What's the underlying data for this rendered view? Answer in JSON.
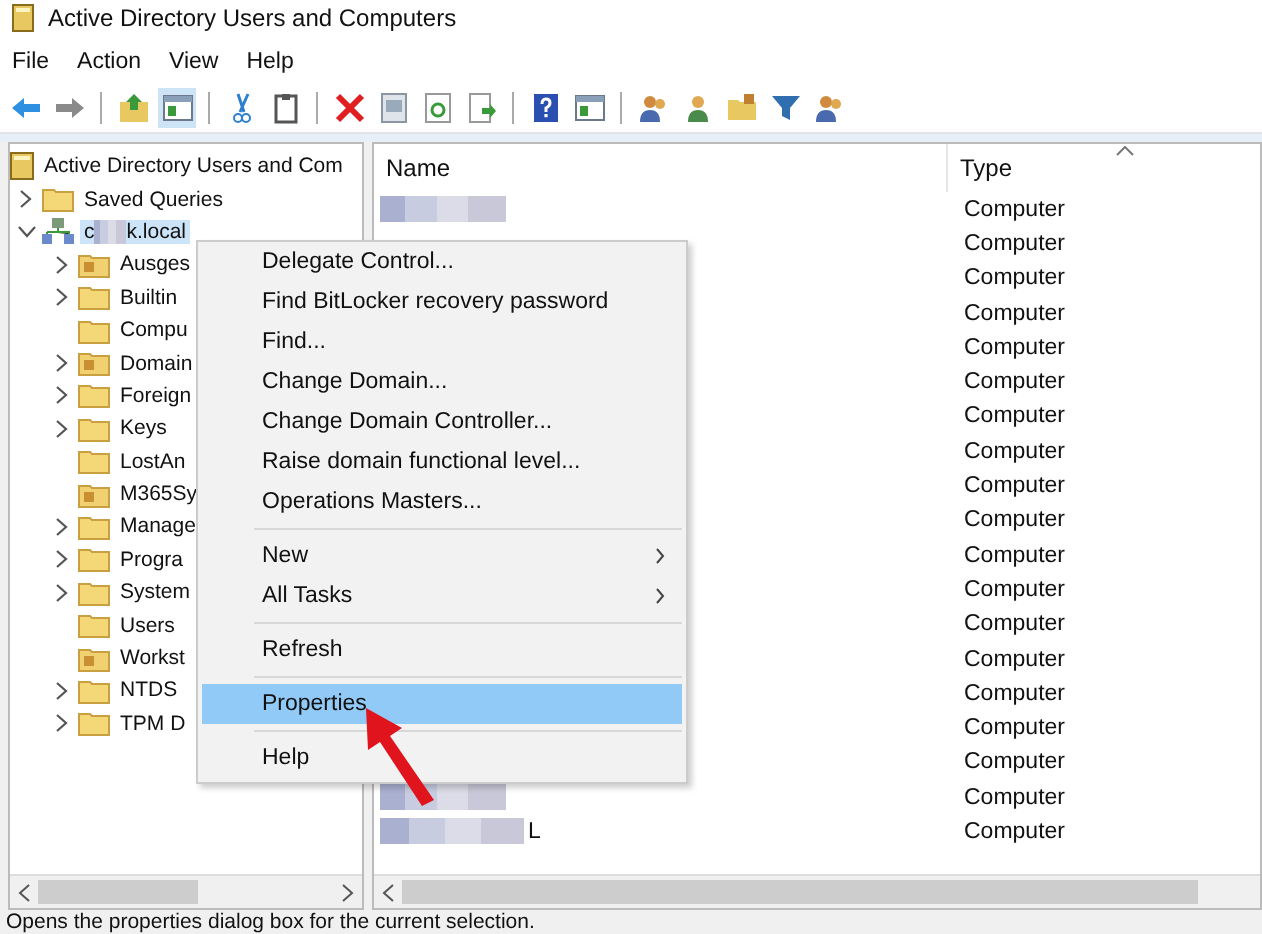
{
  "window": {
    "title": "Active Directory Users and Computers"
  },
  "menu_bar": [
    "File",
    "Action",
    "View",
    "Help"
  ],
  "toolbar": [
    {
      "kind": "back",
      "selected": false
    },
    {
      "kind": "forward",
      "selected": false
    },
    {
      "kind": "separator"
    },
    {
      "kind": "up",
      "selected": false
    },
    {
      "kind": "pane",
      "selected": true
    },
    {
      "kind": "separator"
    },
    {
      "kind": "cut",
      "selected": false
    },
    {
      "kind": "clipboard",
      "selected": false
    },
    {
      "kind": "separator"
    },
    {
      "kind": "delete",
      "selected": false
    },
    {
      "kind": "properties",
      "selected": false
    },
    {
      "kind": "refresh",
      "selected": false
    },
    {
      "kind": "export",
      "selected": false
    },
    {
      "kind": "separator"
    },
    {
      "kind": "help",
      "selected": false
    },
    {
      "kind": "pane",
      "selected": false
    },
    {
      "kind": "separator"
    },
    {
      "kind": "users",
      "selected": false
    },
    {
      "kind": "user",
      "selected": false
    },
    {
      "kind": "folder",
      "selected": false
    },
    {
      "kind": "filter",
      "selected": false
    },
    {
      "kind": "users",
      "selected": false
    }
  ],
  "tree": {
    "label": "Active Directory Users and Com",
    "kind": "root",
    "children": [
      {
        "label": "Saved Queries",
        "kind": "folder",
        "expanded": false,
        "selected": false
      },
      {
        "label": "c",
        "label_after_redaction": "k.local",
        "kind": "domain",
        "expanded": true,
        "selected": true,
        "children": [
          {
            "label": "Ausges",
            "kind": "ou",
            "expanded": false,
            "selected": false
          },
          {
            "label": "Builtin",
            "kind": "folder",
            "expanded": false,
            "selected": false
          },
          {
            "label": "Compu",
            "kind": "folder",
            "selected": false
          },
          {
            "label": "Domain",
            "kind": "ou",
            "expanded": false,
            "selected": false
          },
          {
            "label": "Foreign",
            "kind": "folder",
            "expanded": false,
            "selected": false
          },
          {
            "label": "Keys",
            "kind": "folder",
            "expanded": false,
            "selected": false
          },
          {
            "label": "LostAn",
            "kind": "folder",
            "selected": false
          },
          {
            "label": "M365Sy",
            "kind": "ou",
            "selected": false
          },
          {
            "label": "Manage",
            "kind": "folder",
            "expanded": false,
            "selected": false
          },
          {
            "label": "Progra",
            "kind": "folder",
            "expanded": false,
            "selected": false
          },
          {
            "label": "System",
            "kind": "folder",
            "expanded": false,
            "selected": false
          },
          {
            "label": "Users",
            "kind": "folder",
            "selected": false
          },
          {
            "label": "Workst",
            "kind": "ou",
            "selected": false
          },
          {
            "label": "NTDS",
            "kind": "folder",
            "expanded": false,
            "selected": false
          },
          {
            "label": "TPM D",
            "kind": "folder",
            "expanded": false,
            "selected": false
          }
        ]
      }
    ]
  },
  "table": {
    "columns": [
      {
        "label": "Name",
        "sorted": false
      },
      {
        "label": "Type",
        "sorted": true
      }
    ],
    "rows": [
      {
        "name_redacted": true,
        "type": "Computer"
      },
      {
        "type": "Computer"
      },
      {
        "type": "Computer"
      },
      {
        "type": "Computer"
      },
      {
        "type": "Computer"
      },
      {
        "type": "Computer"
      },
      {
        "type": "Computer"
      },
      {
        "type": "Computer"
      },
      {
        "type": "Computer"
      },
      {
        "type": "Computer"
      },
      {
        "type": "Computer"
      },
      {
        "type": "Computer"
      },
      {
        "type": "Computer"
      },
      {
        "type": "Computer"
      },
      {
        "type": "Computer"
      },
      {
        "type": "Computer"
      },
      {
        "type": "Computer"
      },
      {
        "name_redacted": true,
        "type": "Computer"
      },
      {
        "name_redacted": true,
        "name_after_redaction": "L",
        "type": "Computer"
      }
    ]
  },
  "context_menu": {
    "items": [
      {
        "kind": "item",
        "label": "Delegate Control...",
        "selected": false
      },
      {
        "kind": "item",
        "label": "Find BitLocker recovery password",
        "selected": false
      },
      {
        "kind": "item",
        "label": "Find...",
        "selected": false
      },
      {
        "kind": "item",
        "label": "Change Domain...",
        "selected": false
      },
      {
        "kind": "item",
        "label": "Change Domain Controller...",
        "selected": false
      },
      {
        "kind": "item",
        "label": "Raise domain functional level...",
        "selected": false
      },
      {
        "kind": "item",
        "label": "Operations Masters...",
        "selected": false
      },
      {
        "kind": "separator"
      },
      {
        "kind": "submenu",
        "label": "New",
        "selected": false
      },
      {
        "kind": "submenu",
        "label": "All Tasks",
        "selected": false
      },
      {
        "kind": "separator"
      },
      {
        "kind": "item",
        "label": "Refresh",
        "selected": false
      },
      {
        "kind": "separator"
      },
      {
        "kind": "item",
        "label": "Properties",
        "selected": true
      },
      {
        "kind": "separator"
      },
      {
        "kind": "item",
        "label": "Help",
        "selected": false
      }
    ]
  },
  "annotation": {
    "kind": "arrow"
  },
  "status_bar": "Opens the properties dialog box for the current selection."
}
